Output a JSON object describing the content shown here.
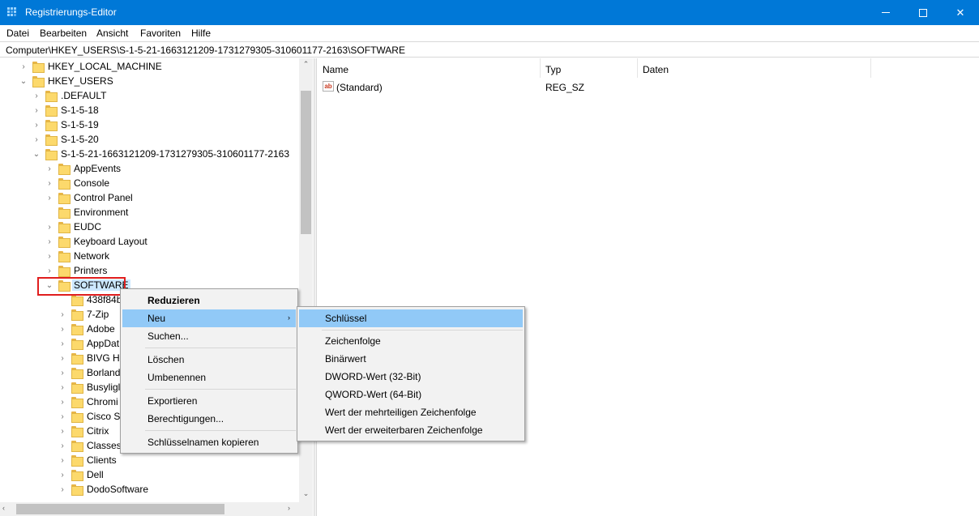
{
  "window": {
    "title": "Registrierungs-Editor",
    "minimize_glyph": "",
    "maximize_glyph": "",
    "close_glyph": "✕"
  },
  "menu": {
    "items": [
      "Datei",
      "Bearbeiten",
      "Ansicht",
      "Favoriten",
      "Hilfe"
    ]
  },
  "address": {
    "path": "Computer\\HKEY_USERS\\S-1-5-21-1663121209-1731279305-310601177-2163\\SOFTWARE"
  },
  "tree": {
    "rows": [
      {
        "label": "HKEY_LOCAL_MACHINE",
        "chevron": "›",
        "selected": false
      },
      {
        "label": "HKEY_USERS",
        "chevron": "⌄",
        "selected": false
      },
      {
        "label": ".DEFAULT",
        "chevron": "›",
        "selected": false
      },
      {
        "label": "S-1-5-18",
        "chevron": "›",
        "selected": false
      },
      {
        "label": "S-1-5-19",
        "chevron": "›",
        "selected": false
      },
      {
        "label": "S-1-5-20",
        "chevron": "›",
        "selected": false
      },
      {
        "label": "S-1-5-21-1663121209-1731279305-310601177-2163",
        "chevron": "⌄",
        "selected": false
      },
      {
        "label": "AppEvents",
        "chevron": "›",
        "selected": false
      },
      {
        "label": "Console",
        "chevron": "›",
        "selected": false
      },
      {
        "label": "Control Panel",
        "chevron": "›",
        "selected": false
      },
      {
        "label": "Environment",
        "chevron": "",
        "selected": false
      },
      {
        "label": "EUDC",
        "chevron": "›",
        "selected": false
      },
      {
        "label": "Keyboard Layout",
        "chevron": "›",
        "selected": false
      },
      {
        "label": "Network",
        "chevron": "›",
        "selected": false
      },
      {
        "label": "Printers",
        "chevron": "›",
        "selected": false
      },
      {
        "label": "SOFTWARE",
        "chevron": "⌄",
        "selected": true
      },
      {
        "label": "438f84b",
        "chevron": "",
        "selected": false
      },
      {
        "label": "7-Zip",
        "chevron": "›",
        "selected": false
      },
      {
        "label": "Adobe",
        "chevron": "›",
        "selected": false
      },
      {
        "label": "AppDat",
        "chevron": "›",
        "selected": false
      },
      {
        "label": "BIVG Ha",
        "chevron": "›",
        "selected": false
      },
      {
        "label": "Borland",
        "chevron": "›",
        "selected": false
      },
      {
        "label": "Busyligl",
        "chevron": "›",
        "selected": false
      },
      {
        "label": "Chromi",
        "chevron": "›",
        "selected": false
      },
      {
        "label": "Cisco Sy",
        "chevron": "›",
        "selected": false
      },
      {
        "label": "Citrix",
        "chevron": "›",
        "selected": false
      },
      {
        "label": "Classes",
        "chevron": "›",
        "selected": false
      },
      {
        "label": "Clients",
        "chevron": "›",
        "selected": false
      },
      {
        "label": "Dell",
        "chevron": "›",
        "selected": false
      },
      {
        "label": "DodoSoftware",
        "chevron": "›",
        "selected": false
      }
    ]
  },
  "columns": {
    "name": "Name",
    "type": "Typ",
    "data": "Daten"
  },
  "values": [
    {
      "name": "(Standard)",
      "type": "REG_SZ",
      "data": "",
      "icon": "ab"
    }
  ],
  "context_menu": {
    "items": [
      {
        "label": "Reduzieren",
        "bold": true
      },
      {
        "label": "Neu",
        "submenu": true,
        "hover": true
      },
      {
        "label": "Suchen..."
      },
      {
        "label": "Löschen"
      },
      {
        "label": "Umbenennen"
      },
      {
        "label": "Exportieren"
      },
      {
        "label": "Berechtigungen..."
      },
      {
        "label": "Schlüsselnamen kopieren"
      }
    ]
  },
  "submenu": {
    "items": [
      {
        "label": "Schlüssel",
        "hover": true
      },
      {
        "label": "Zeichenfolge"
      },
      {
        "label": "Binärwert"
      },
      {
        "label": "DWORD-Wert (32-Bit)"
      },
      {
        "label": "QWORD-Wert (64-Bit)"
      },
      {
        "label": "Wert der mehrteiligen Zeichenfolge"
      },
      {
        "label": "Wert der erweiterbaren Zeichenfolge"
      }
    ]
  },
  "scroll": {
    "up": "⌃",
    "down": "⌄",
    "left": "‹",
    "right": "›"
  },
  "colors": {
    "titlebar": "#0078d7",
    "selection": "#cce8ff",
    "menu_hover": "#91c9f7",
    "highlight_box": "#e01e1e"
  }
}
